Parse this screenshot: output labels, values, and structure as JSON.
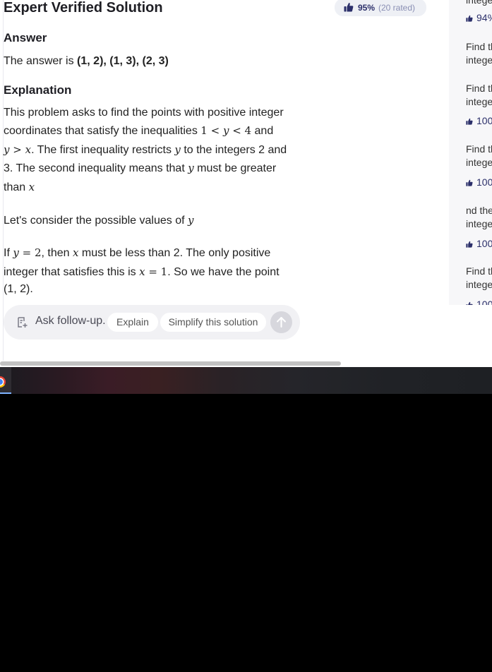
{
  "page": {
    "title": "Expert Verified Solution",
    "rating": {
      "percent": "95%",
      "rated": "(20 rated)"
    }
  },
  "answer": {
    "heading": "Answer",
    "prefix": "The answer is ",
    "value": "(1, 2), (1, 3), (2, 3)"
  },
  "explanation": {
    "heading": "Explanation",
    "p1_l1": "This problem asks to find the points with positive integer",
    "p1_l2a": "coordinates that satisfy the inequalities ",
    "p1_l2_m1": "1",
    "p1_l2_m2": " < ",
    "p1_l2_m3": "y",
    "p1_l2_m4": " < ",
    "p1_l2_m5": "4",
    "p1_l2b": " and",
    "p1_l3_m1": "y",
    "p1_l3_m2": " > ",
    "p1_l3_m3": "x",
    "p1_l3a": ". The first inequality restricts ",
    "p1_l3_m4": "y",
    "p1_l3b": " to the integers 2 and",
    "p1_l4a": "3. The second inequality means that ",
    "p1_l4_m1": "y",
    "p1_l4b": " must be greater",
    "p1_l5a": "than ",
    "p1_l5_m1": "x",
    "p2a": "Let's consider the possible values of ",
    "p2_m1": "y",
    "p3_l1a": "If ",
    "p3_l1_m1": "y",
    "p3_l1_m2": " = ",
    "p3_l1_m3": "2",
    "p3_l1b": ", then ",
    "p3_l1_m4": "x",
    "p3_l1c": " must be less than 2. The only positive",
    "p3_l2a": "integer that satisfies this is ",
    "p3_l2_m1": "x",
    "p3_l2_m2": " = ",
    "p3_l2_m3": "1",
    "p3_l2b": ". So we have the point",
    "p3_l3": "(1, 2)."
  },
  "sidebar": {
    "items": [
      {
        "text": "intege"
      },
      {
        "stat": "94%"
      },
      {
        "text1": "Find th",
        "text2": "intege"
      },
      {
        "text1": "Find th",
        "text2": "intege"
      },
      {
        "stat": "100"
      },
      {
        "text1": "Find th",
        "text2": "intege"
      },
      {
        "stat": "100"
      },
      {
        "text1": "nd the",
        "text2": "intege"
      },
      {
        "stat": "100"
      },
      {
        "text1": "Find th",
        "text2": "intege"
      },
      {
        "stat": "100"
      }
    ]
  },
  "followup": {
    "placeholder": "Ask follow-up...",
    "chips": [
      "Explain",
      "Simplify this solution"
    ]
  },
  "colors": {
    "accent": "#2b2f6a",
    "muted": "#8a8fb4",
    "pill_bg": "#eef0f5",
    "input_bg": "#f1f1f4"
  },
  "icons": [
    "thumbs-up-icon",
    "note-plus-icon",
    "arrow-up-icon",
    "chrome-icon"
  ]
}
